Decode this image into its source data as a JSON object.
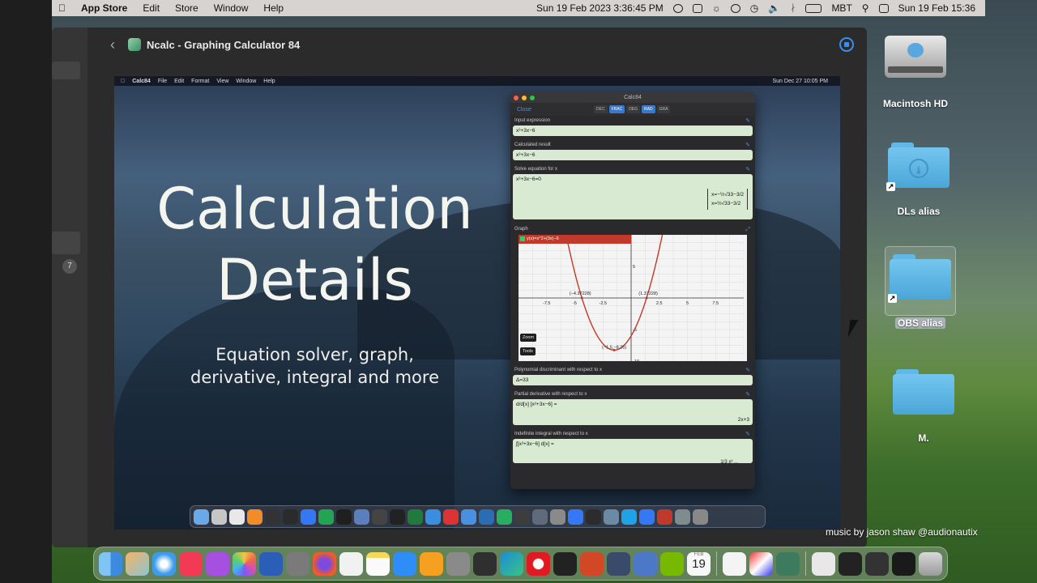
{
  "menubar": {
    "app_name": "App Store",
    "items": [
      "Edit",
      "Store",
      "Window",
      "Help"
    ],
    "datetime_left": "Sun 19 Feb 2023  3:36:45 PM",
    "input_source": "MBT",
    "datetime_right": "Sun 19 Feb  15:36"
  },
  "window": {
    "title": "Ncalc - Graphing Calculator 84",
    "sidebar_badge": "7"
  },
  "screenshot": {
    "menubar": {
      "app_name": "Calc84",
      "items": [
        "File",
        "Edit",
        "Format",
        "View",
        "Window",
        "Help"
      ],
      "datetime": "Sun Dec 27  10:05 PM"
    },
    "promo": {
      "title_line1": "Calculation",
      "title_line2": "Details",
      "subtitle_line1": "Equation solver, graph,",
      "subtitle_line2": "derivative, integral and more"
    },
    "calc": {
      "title": "Calc84",
      "close_label": "Close",
      "modes": [
        {
          "label": "DEC",
          "active": false
        },
        {
          "label": "FRAC",
          "active": true
        },
        {
          "label": "DEG",
          "active": false
        },
        {
          "label": "RAD",
          "active": true
        },
        {
          "label": "GRA",
          "active": false
        }
      ],
      "sections": {
        "input_label": "Input expression",
        "input_value": "x²+3x−6",
        "result_label": "Calculated result",
        "result_value": "x²+3x−6",
        "solve_label": "Solve equation for x",
        "solve_equation": "x²+3x−6=0",
        "solve_root1": "x=−½√33−3/2",
        "solve_root2": "x=½√33−3/2",
        "graph_label": "Graph",
        "graph_legend": "y(x)=x^2+(3x)−6",
        "graph_zoom": "Zoom",
        "graph_tools": "Tools",
        "discriminant_label": "Polynomial discriminant with respect to x",
        "discriminant_value": "Δ=33",
        "derivative_label": "Partial derivative with respect to x",
        "derivative_expr": "d/d[x] [x²+3x−6] =",
        "derivative_value": "2x+3",
        "integral_label": "Indefinite integral with respect to x",
        "integral_expr": "∫[x²+3x−6] d[x] =",
        "integral_value": "1/3 x³ ..."
      }
    }
  },
  "chart_data": {
    "type": "line",
    "title": "",
    "series": [
      {
        "name": "y(x)=x^2+(3x)−6",
        "expression": "x^2+3x-6"
      }
    ],
    "xlim": [
      -10,
      10
    ],
    "ylim": [
      -10,
      10
    ],
    "x_ticks": [
      -7.5,
      -5,
      -2.5,
      2.5,
      5,
      7.5
    ],
    "y_ticks": [
      5,
      -5,
      -10
    ],
    "annotations": [
      {
        "label": "(−4.37228)",
        "x": -4.37228,
        "y": 0
      },
      {
        "label": "(1.37228)",
        "x": 1.37228,
        "y": 0
      },
      {
        "label": "(−1.5,−8.25)",
        "x": -1.5,
        "y": -8.25
      }
    ],
    "grid": true,
    "legend_color": "#c0392b"
  },
  "desktop": {
    "icons": [
      {
        "label": "Macintosh HD"
      },
      {
        "label": "DLs alias"
      },
      {
        "label": "OBS alias"
      },
      {
        "label": "M."
      }
    ],
    "credit": "music by jason shaw @audionautix",
    "dock_calendar_month": "FEB",
    "dock_calendar_day": "19"
  }
}
